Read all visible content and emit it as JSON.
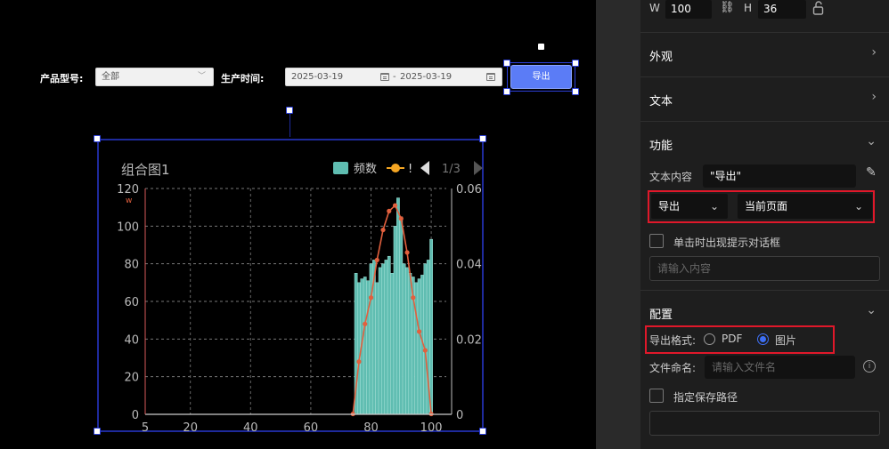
{
  "filters": {
    "model_label": "产品型号:",
    "model_value": "全部",
    "time_label": "生产时间:",
    "date_start": "2025-03-19",
    "date_sep": "-",
    "date_end": "2025-03-19",
    "export_label": "导出"
  },
  "chart_data": {
    "type": "bar",
    "title": "组合图1",
    "legend": {
      "items": [
        "频数",
        "!"
      ],
      "page": "1/3",
      "placement": "top-right"
    },
    "x_ticks": [
      "5",
      "20",
      "40",
      "60",
      "80",
      "100"
    ],
    "xlim": [
      5,
      105
    ],
    "y_left_ticks": [
      "0",
      "20",
      "40",
      "60",
      "80",
      "100",
      "120"
    ],
    "ylim_left": [
      0,
      120
    ],
    "y_left_unit": "w",
    "y_right_ticks": [
      "0",
      "0.02",
      "0.04",
      "0.06"
    ],
    "ylim_right": [
      0,
      0.06
    ],
    "grid": true,
    "series": [
      {
        "name": "频数",
        "type": "bar",
        "color": "#5fbdb1",
        "x": [
          75,
          76,
          77,
          78,
          79,
          80,
          81,
          82,
          83,
          84,
          85,
          86,
          87,
          88,
          89,
          90,
          91,
          92,
          93,
          94,
          95,
          96,
          97,
          98,
          99,
          100
        ],
        "values": [
          75,
          70,
          72,
          73,
          71,
          80,
          82,
          70,
          78,
          80,
          82,
          84,
          75,
          100,
          115,
          105,
          80,
          78,
          75,
          73,
          70,
          72,
          74,
          80,
          82,
          93
        ]
      },
      {
        "type": "line",
        "color": "#e2603e",
        "x": [
          74,
          76,
          78,
          80,
          82,
          84,
          86,
          88,
          90,
          92,
          94,
          96,
          98,
          100
        ],
        "values": [
          0.0001,
          0.014,
          0.024,
          0.031,
          0.041,
          0.049,
          0.054,
          0.0555,
          0.052,
          0.043,
          0.031,
          0.022,
          0.017,
          0.0001
        ]
      }
    ]
  },
  "panel": {
    "w_label": "W",
    "w_value": "100",
    "h_label": "H",
    "h_value": "36",
    "sections": {
      "appearance": "外观",
      "text": "文本",
      "function": "功能",
      "config": "配置"
    },
    "text_content_label": "文本内容",
    "text_content_value": "\"导出\"",
    "action_select": "导出",
    "scope_select": "当前页面",
    "confirm_checkbox_label": "单击时出现提示对话框",
    "confirm_placeholder": "请输入内容",
    "format_label": "导出格式:",
    "format_options": [
      "PDF",
      "图片"
    ],
    "format_selected": "图片",
    "filename_label": "文件命名:",
    "filename_placeholder": "请输入文件名",
    "save_path_label": "指定保存路径",
    "colors": {
      "highlight": "#e0182a",
      "accent": "#3d6ff6"
    }
  }
}
